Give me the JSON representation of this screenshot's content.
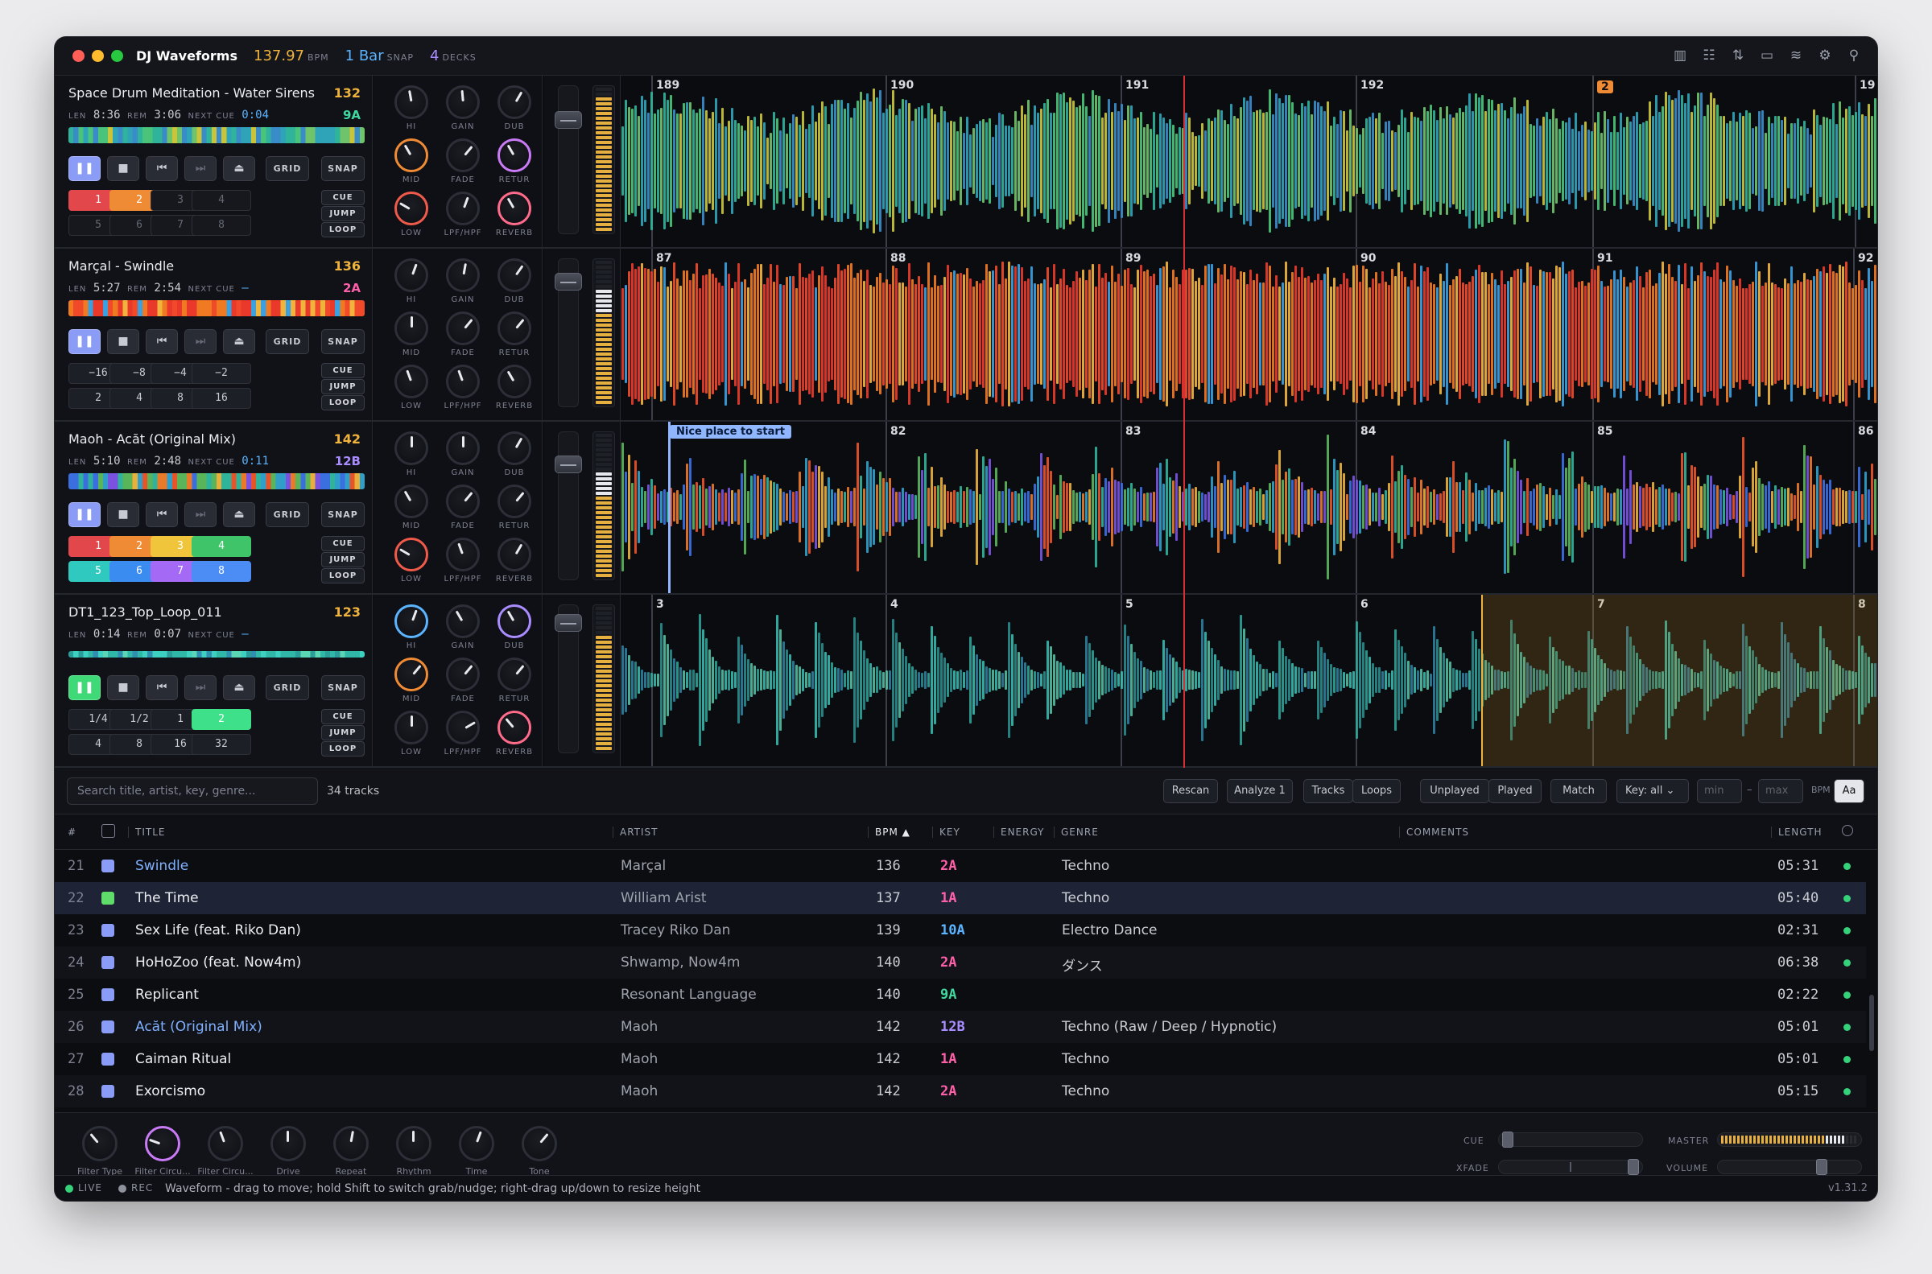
{
  "titlebar": {
    "app": "DJ Waveforms",
    "bpm": "137.97",
    "bpm_unit": "BPM",
    "snap": "1 Bar",
    "snap_unit": "SNAP",
    "decks": "4",
    "decks_unit": "DECKS"
  },
  "decks": [
    {
      "title": "Space Drum Meditation - Water Sirens",
      "bpm": "132",
      "key": "9A",
      "key_color": "#3fd9a0",
      "len": "8:36",
      "rem": "3:06",
      "next_cue": "0:04",
      "play_active": true,
      "pads": [
        [
          "1",
          "#e2474b"
        ],
        [
          "2",
          "#ef8a35"
        ],
        [
          "3",
          ""
        ],
        [
          "4",
          ""
        ],
        [
          "5",
          ""
        ],
        [
          "6",
          ""
        ],
        [
          "7",
          ""
        ],
        [
          "8",
          ""
        ]
      ],
      "bars": [
        "189",
        "190",
        "191",
        "192",
        "2",
        "19"
      ],
      "palette": "rainbow-green"
    },
    {
      "title": "Marçal - Swindle",
      "bpm": "136",
      "key": "2A",
      "key_color": "#ff5fa8",
      "len": "5:27",
      "rem": "2:54",
      "next_cue": "–",
      "play_active": true,
      "pads": [
        [
          "−16",
          ""
        ],
        [
          "−8",
          ""
        ],
        [
          "−4",
          ""
        ],
        [
          "−2",
          ""
        ],
        [
          "2",
          ""
        ],
        [
          "4",
          ""
        ],
        [
          "8",
          ""
        ],
        [
          "16",
          ""
        ]
      ],
      "bars": [
        "87",
        "88",
        "89",
        "90",
        "91",
        "92"
      ],
      "palette": "hot"
    },
    {
      "title": "Maoh - Acăt (Original Mix)",
      "bpm": "142",
      "key": "12B",
      "key_color": "#a98cff",
      "len": "5:10",
      "rem": "2:48",
      "next_cue": "0:11",
      "play_active": true,
      "pads": [
        [
          "1",
          "#e2474b"
        ],
        [
          "2",
          "#ef8a35"
        ],
        [
          "3",
          "#f0c53c"
        ],
        [
          "4",
          "#3fc46a"
        ],
        [
          "5",
          "#2fc9c0"
        ],
        [
          "6",
          "#3b8cf0"
        ],
        [
          "7",
          "#a46af5"
        ],
        [
          "8",
          "#4b8cf5"
        ]
      ],
      "bars": [
        "82",
        "83",
        "84",
        "85",
        "86"
      ],
      "cue_label": "Nice place to start",
      "palette": "rainbow"
    },
    {
      "title": "DT1_123_Top_Loop_011",
      "bpm": "123",
      "key": "",
      "key_color": "#fff",
      "len": "0:14",
      "rem": "0:07",
      "next_cue": "–",
      "play_active": false,
      "pads": [
        [
          "1/4",
          ""
        ],
        [
          "1/2",
          ""
        ],
        [
          "1",
          ""
        ],
        [
          "2",
          "#3fe08a"
        ],
        [
          "4",
          ""
        ],
        [
          "8",
          ""
        ],
        [
          "16",
          ""
        ],
        [
          "32",
          ""
        ]
      ],
      "bars": [
        "3",
        "4",
        "5",
        "6",
        "7",
        "8"
      ],
      "palette": "teal"
    }
  ],
  "deck_labels": {
    "len": "LEN",
    "rem": "REM",
    "next_cue": "NEXT CUE",
    "grid": "GRID",
    "snap": "SNAP",
    "cue": "CUE",
    "jump": "JUMP",
    "loop": "LOOP"
  },
  "knob_labels": [
    "HI",
    "GAIN",
    "DUB",
    "MID",
    "FADE",
    "RETUR",
    "LOW",
    "LPF/HPF",
    "REVERB"
  ],
  "filter": {
    "search_placeholder": "Search title, artist, key, genre...",
    "count": "34 tracks",
    "rescan": "Rescan",
    "analyze": "Analyze 1",
    "tracks": "Tracks",
    "loops": "Loops",
    "unplayed": "Unplayed",
    "played": "Played",
    "match": "Match",
    "key_select": "Key: all",
    "min": "min",
    "dash": "–",
    "max": "max",
    "bpm": "BPM",
    "case": "Aa"
  },
  "columns": {
    "num": "#",
    "title": "TITLE",
    "artist": "ARTIST",
    "bpm": "BPM ▲",
    "key": "KEY",
    "energy": "ENERGY",
    "genre": "GENRE",
    "comments": "COMMENTS",
    "length": "LENGTH"
  },
  "tracks": [
    {
      "n": "21",
      "title": "Swindle",
      "artist": "Marçal",
      "bpm": "136",
      "key": "2A",
      "key_color": "#ff5fa8",
      "genre": "Techno",
      "length": "05:31",
      "swatch": "#8a9cf5",
      "link": true
    },
    {
      "n": "22",
      "title": "The Time",
      "artist": "William Arist",
      "bpm": "137",
      "key": "1A",
      "key_color": "#ff5fa8",
      "genre": "Techno",
      "length": "05:40",
      "swatch": "#5fdc6a",
      "link": false
    },
    {
      "n": "23",
      "title": "Sex Life (feat. Riko Dan)",
      "artist": "Tracey Riko Dan",
      "bpm": "139",
      "key": "10A",
      "key_color": "#5ab4ff",
      "genre": "Electro Dance",
      "length": "02:31",
      "swatch": "#8a9cf5",
      "link": false
    },
    {
      "n": "24",
      "title": "HoHoZoo (feat. Now4m)",
      "artist": "Shwamp, Now4m",
      "bpm": "140",
      "key": "2A",
      "key_color": "#ff5fa8",
      "genre": "ダンス",
      "length": "06:38",
      "swatch": "#8a9cf5",
      "link": false
    },
    {
      "n": "25",
      "title": "Replicant",
      "artist": "Resonant Language",
      "bpm": "140",
      "key": "9A",
      "key_color": "#3fd9a0",
      "genre": "",
      "length": "02:22",
      "swatch": "#8a9cf5",
      "link": false
    },
    {
      "n": "26",
      "title": "Acăt (Original Mix)",
      "artist": "Maoh",
      "bpm": "142",
      "key": "12B",
      "key_color": "#a98cff",
      "genre": "Techno (Raw / Deep / Hypnotic)",
      "length": "05:01",
      "swatch": "#8a9cf5",
      "link": true
    },
    {
      "n": "27",
      "title": "Caiman Ritual",
      "artist": "Maoh",
      "bpm": "142",
      "key": "1A",
      "key_color": "#ff5fa8",
      "genre": "Techno",
      "length": "05:01",
      "swatch": "#8a9cf5",
      "link": false
    },
    {
      "n": "28",
      "title": "Exorcismo",
      "artist": "Maoh",
      "bpm": "142",
      "key": "2A",
      "key_color": "#ff5fa8",
      "genre": "Techno",
      "length": "05:15",
      "swatch": "#8a9cf5",
      "link": false
    }
  ],
  "fx": [
    "Filter Type",
    "Filter Circu...",
    "Filter Circu...",
    "Drive",
    "Repeat",
    "Rhythm",
    "Time",
    "Tone"
  ],
  "mixer": {
    "cue": "CUE",
    "xfade": "XFADE",
    "master": "MASTER",
    "volume": "VOLUME"
  },
  "status": {
    "live": "LIVE",
    "rec": "REC",
    "hint": "Waveform - drag to move; hold Shift to switch grab/nudge; right-drag up/down to resize height",
    "version": "v1.31.2"
  }
}
